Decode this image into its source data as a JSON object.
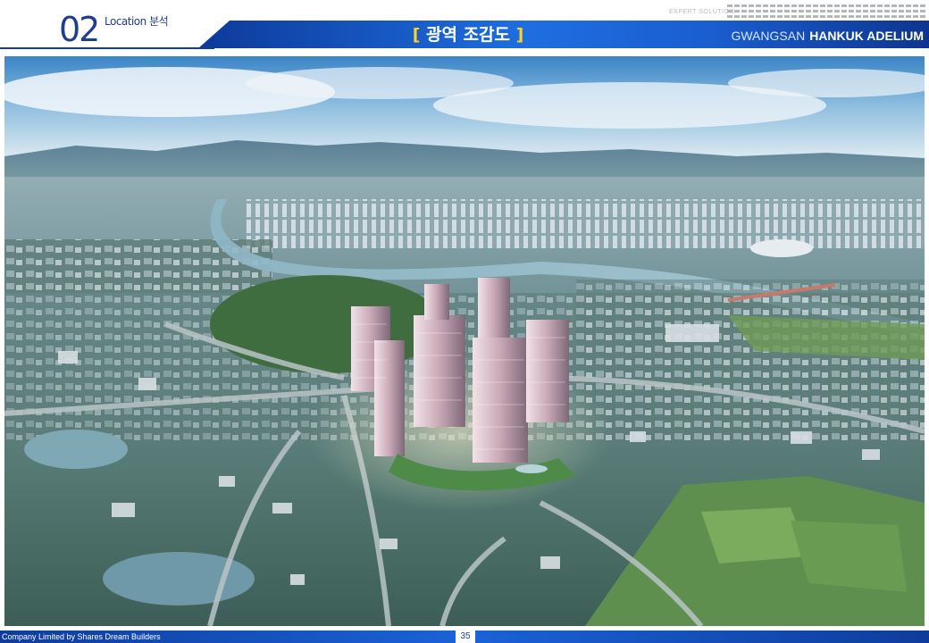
{
  "header": {
    "section_number": "02",
    "section_title": "Location 분석",
    "page_heading": {
      "open": "[",
      "text": " 광역 조감도 ",
      "close": "]"
    },
    "expert_label": "EXPERT SOLUTION",
    "brand": {
      "location": "GWANGSAN",
      "name": "HANKUK ADELIUM"
    },
    "colors": {
      "primary": "#1f3e8c",
      "bar": "#1e6ee0",
      "bracket": "#ffd21e"
    }
  },
  "main_image": {
    "kind": "aerial-rendering",
    "icon": "aerial-city-photo"
  },
  "footer": {
    "company": "Company Limited by Shares Dream Builders",
    "page_number": "35"
  }
}
